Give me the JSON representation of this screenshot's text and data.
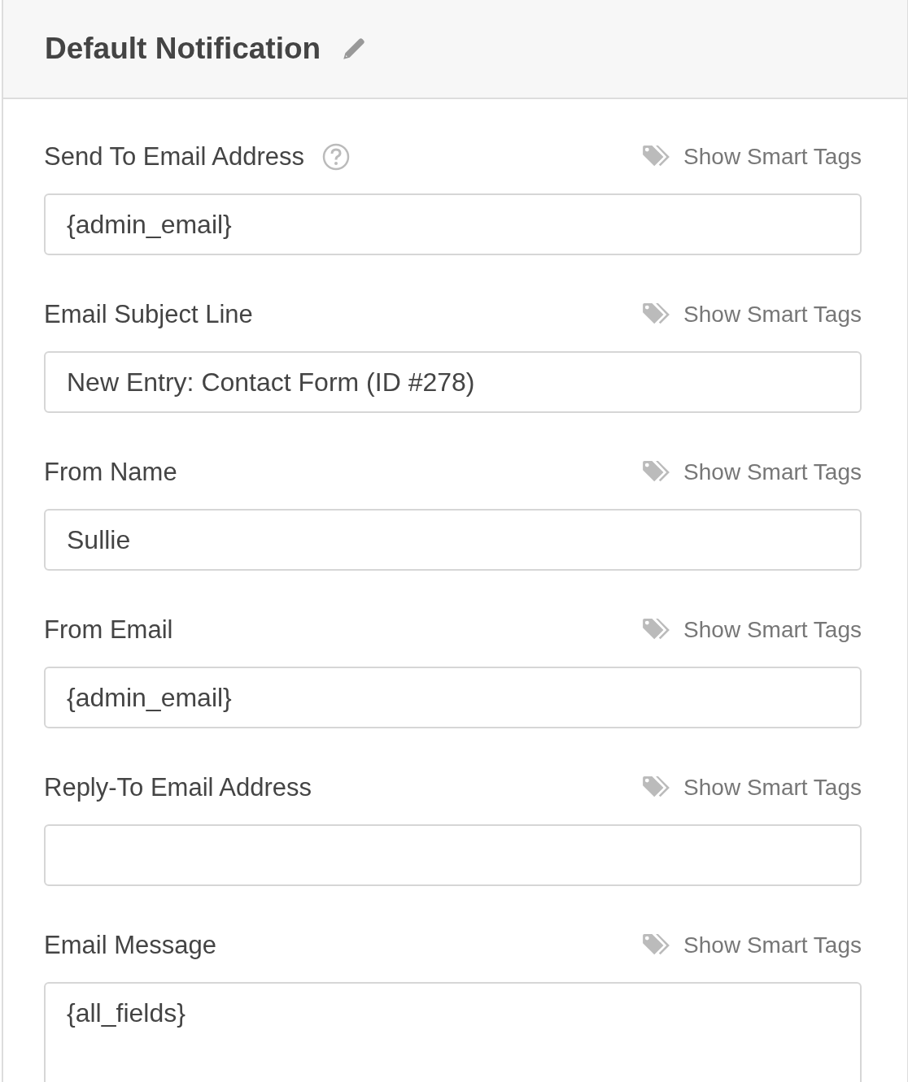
{
  "header": {
    "title": "Default Notification"
  },
  "fields": [
    {
      "label": "Send To Email Address",
      "help": true,
      "smart_tags": "Show Smart Tags",
      "kind": "input",
      "value": "{admin_email}"
    },
    {
      "label": "Email Subject Line",
      "help": false,
      "smart_tags": "Show Smart Tags",
      "kind": "input",
      "value": "New Entry: Contact Form (ID #278)"
    },
    {
      "label": "From Name",
      "help": false,
      "smart_tags": "Show Smart Tags",
      "kind": "input",
      "value": "Sullie"
    },
    {
      "label": "From Email",
      "help": false,
      "smart_tags": "Show Smart Tags",
      "kind": "input",
      "value": "{admin_email}"
    },
    {
      "label": "Reply-To Email Address",
      "help": false,
      "smart_tags": "Show Smart Tags",
      "kind": "input"
    },
    {
      "label": "Email Message",
      "help": false,
      "smart_tags": "Show Smart Tags",
      "kind": "textarea",
      "value": "{all_fields}"
    }
  ]
}
